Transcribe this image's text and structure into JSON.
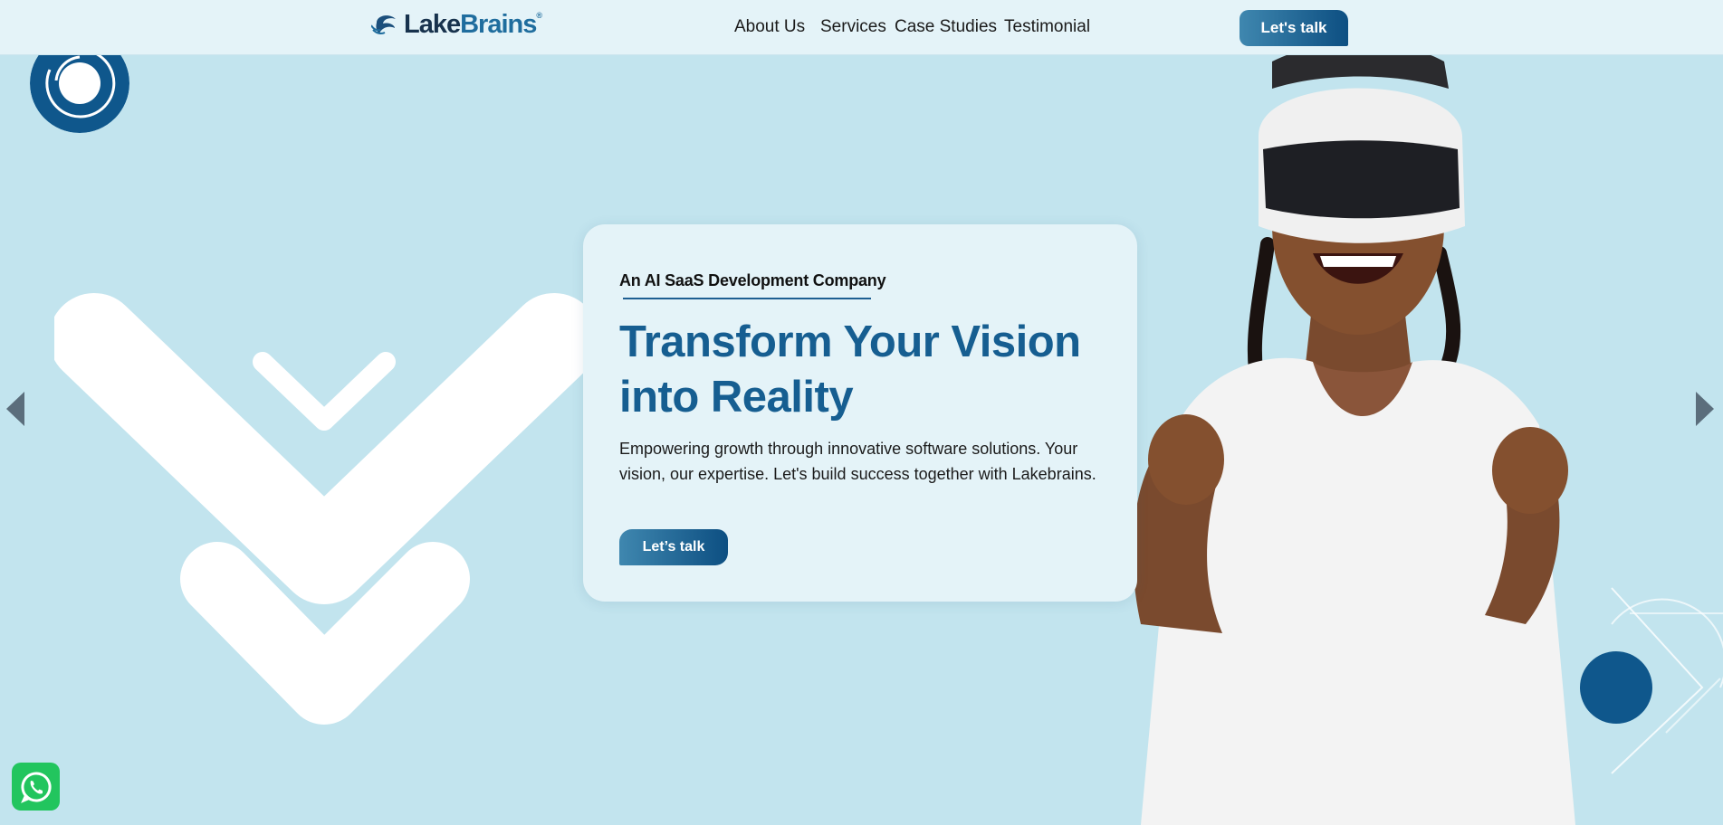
{
  "nav": {
    "logo": {
      "lake": "Lake",
      "brains": "Brains",
      "reg": "®"
    },
    "links": [
      "About Us",
      "Services",
      "Case Studies",
      "Testimonial"
    ],
    "cta_label": "Let's talk"
  },
  "hero": {
    "eyebrow": "An AI SaaS Development Company",
    "headline": "Transform Your Vision into Reality",
    "subtext": "Empowering growth through innovative software solutions. Your vision, our expertise. Let's build success together with Lakebrains.",
    "cta_label": "Let’s talk"
  },
  "colors": {
    "background": "#c2e4ee",
    "nav_bg": "#e4f3f8",
    "brand_dark": "#0d4f82",
    "brand": "#165e91",
    "whatsapp": "#22c55e"
  },
  "icons": [
    "wave-logo-icon",
    "ring-decoration-icon",
    "chevron-left-icon",
    "chevron-right-icon",
    "whatsapp-icon"
  ]
}
